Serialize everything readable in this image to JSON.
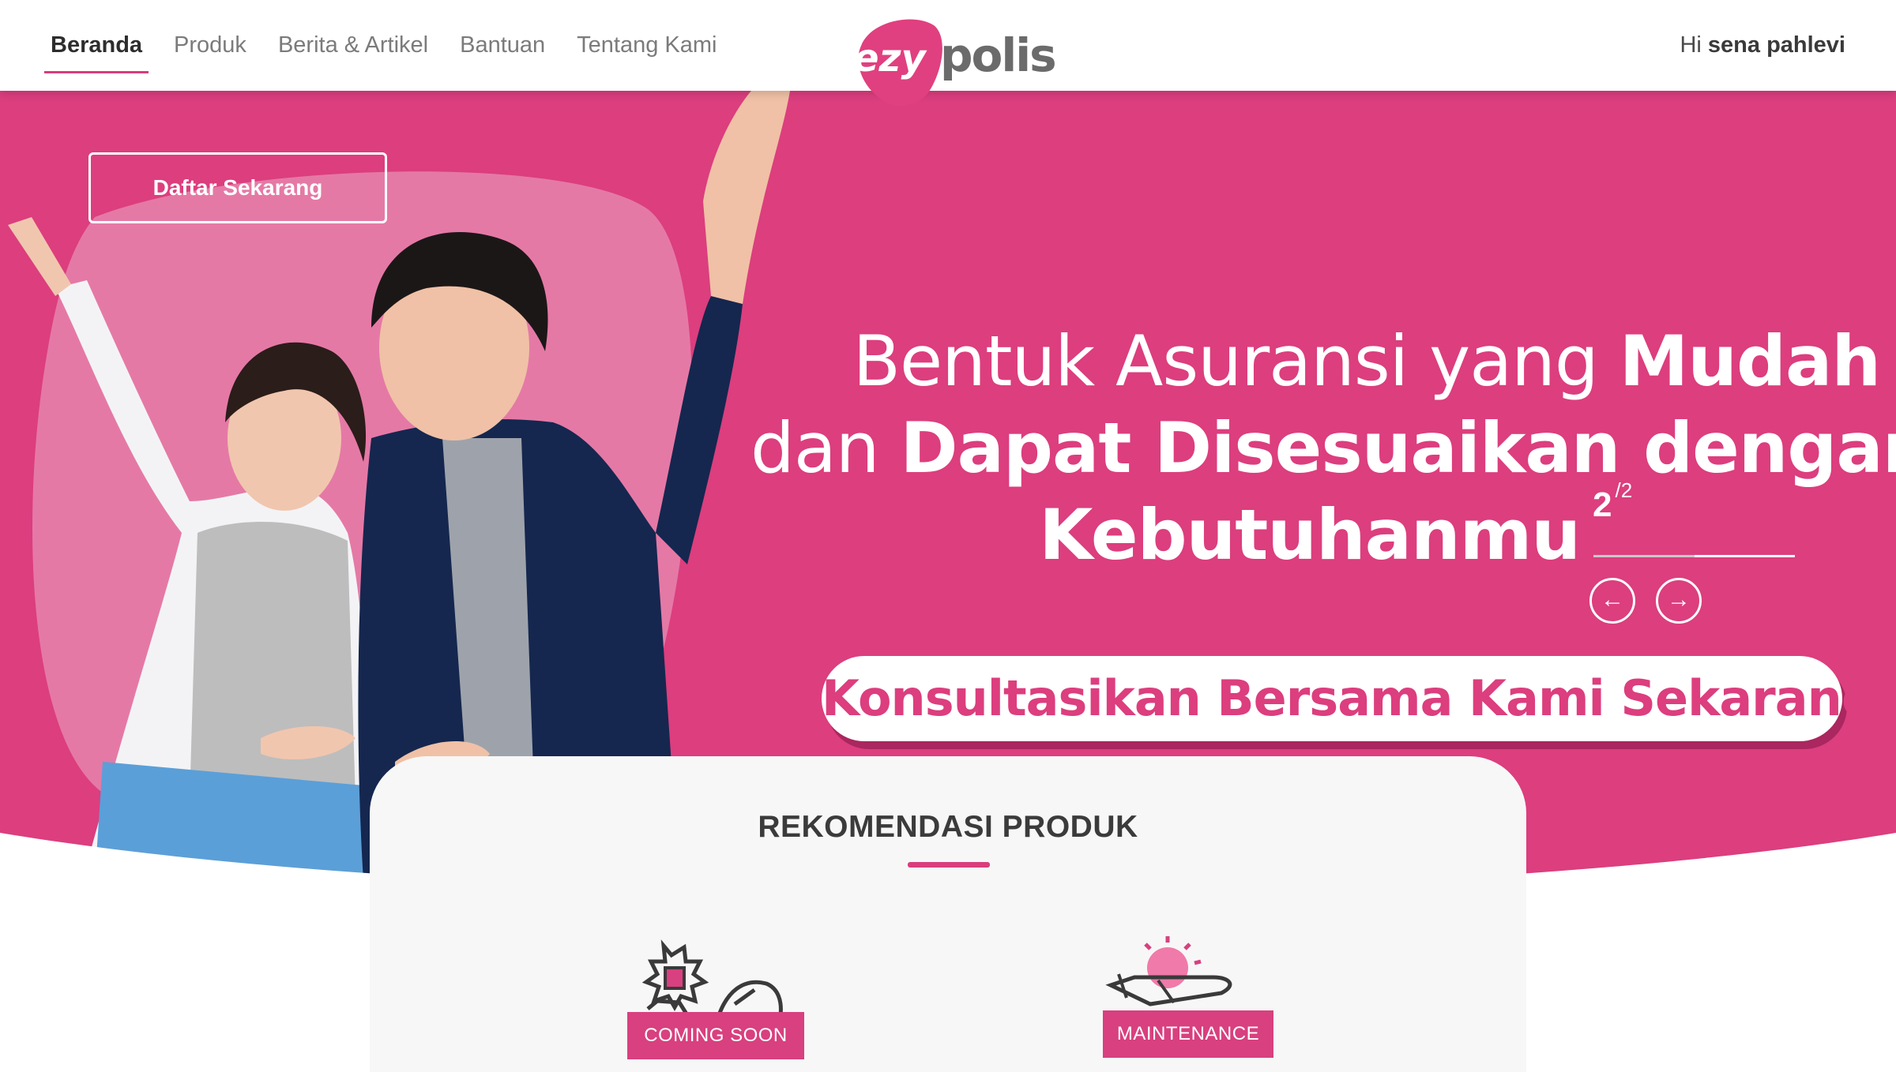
{
  "header": {
    "nav": [
      {
        "label": "Beranda",
        "active": true
      },
      {
        "label": "Produk"
      },
      {
        "label": "Berita & Artikel"
      },
      {
        "label": "Bantuan"
      },
      {
        "label": "Tentang Kami"
      }
    ],
    "logo": {
      "part1": "ezy",
      "part2": "polis"
    },
    "greeting_prefix": "Hi",
    "user_name": "sena pahlevi"
  },
  "hero": {
    "cta_label": "Daftar Sekarang",
    "headline": {
      "line1_normal": "Bentuk Asuransi yang ",
      "line1_bold": "Mudah",
      "line2_normal": "dan ",
      "line2_bold": "Dapat Disesuaikan dengan",
      "line3_bold": "Kebutuhanmu"
    },
    "slider": {
      "current": "2",
      "total": "/2",
      "progress": 0.5
    },
    "prev_icon": "arrow-left-icon",
    "next_icon": "arrow-right-icon",
    "consult_label": "Konsultasikan Bersama Kami Sekarang"
  },
  "recommendations": {
    "title": "REKOMENDASI PRODUK",
    "products": [
      {
        "icon": "car-accident-icon",
        "badge": "COMING SOON"
      },
      {
        "icon": "travel-plane-icon",
        "badge": "MAINTENANCE"
      }
    ]
  },
  "colors": {
    "brand": "#dc3e7e",
    "accent": "#d93d7c",
    "text_dark": "#3b3b3b"
  }
}
